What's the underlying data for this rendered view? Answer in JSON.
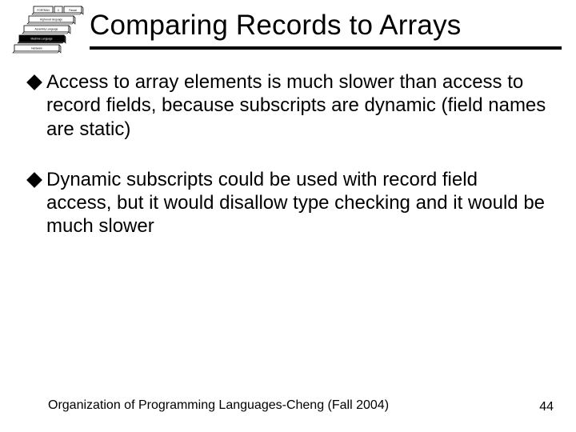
{
  "logo": {
    "labels": [
      "FORTRAN",
      "C",
      "Pascal",
      "High-level language",
      "Assembly Language",
      "Machine Language",
      "Hardware"
    ]
  },
  "title": "Comparing Records to Arrays",
  "bullets": [
    "Access to array elements is much slower than access to record fields, because subscripts are dynamic (field names are static)",
    "Dynamic subscripts could be used with record field access, but it would disallow type checking and it would be much slower"
  ],
  "footer": {
    "left": "Organization of Programming Languages-Cheng (Fall 2004)",
    "page": "44"
  }
}
